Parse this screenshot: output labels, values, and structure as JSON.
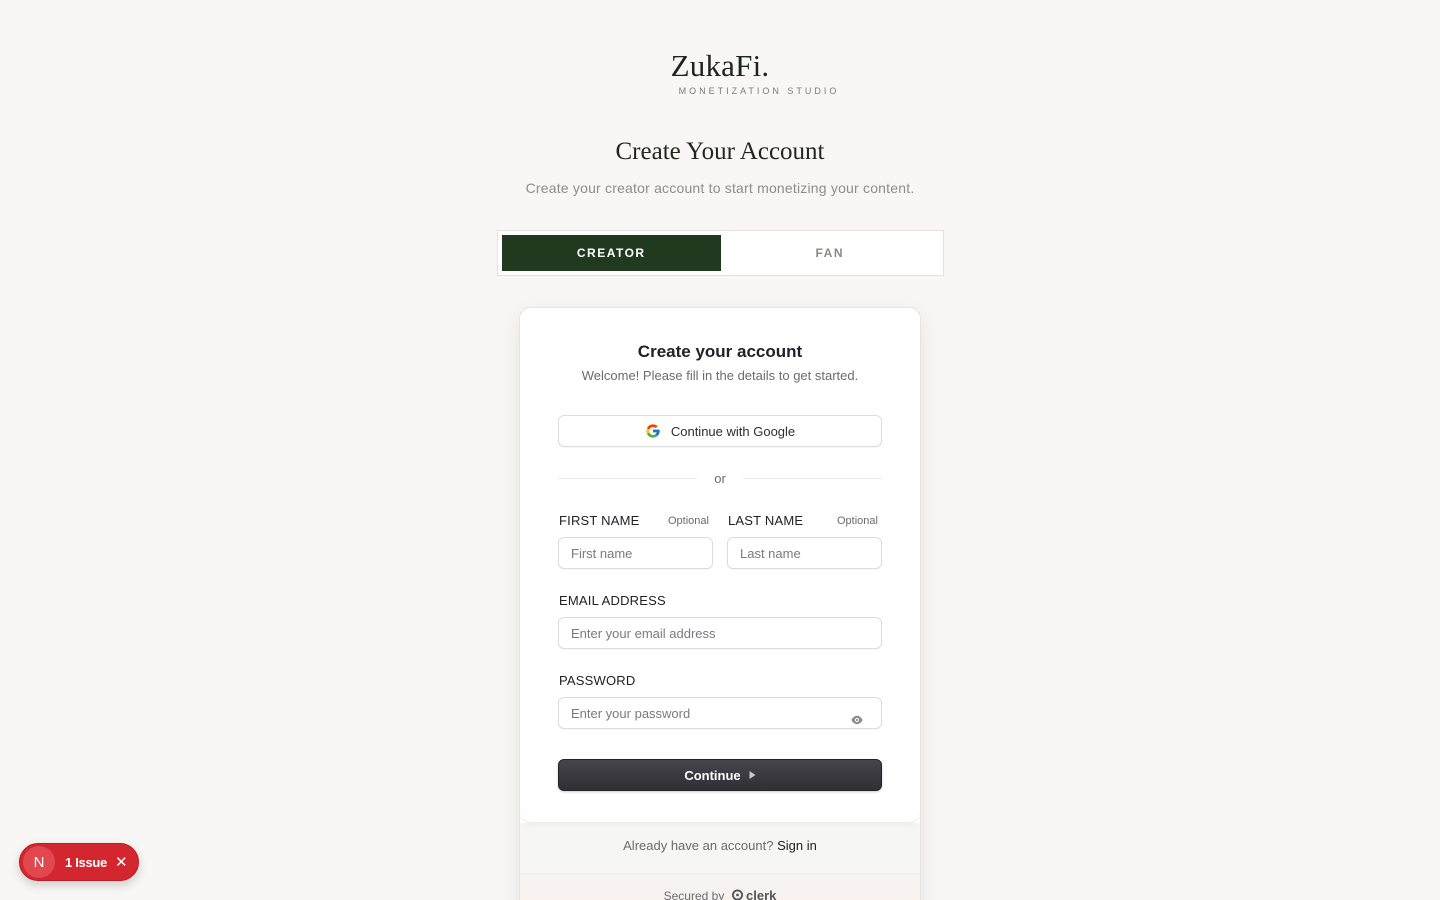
{
  "brand": {
    "name": "ZukaFi.",
    "tagline": "MONETIZATION STUDIO"
  },
  "page": {
    "heading": "Create Your Account",
    "subheading": "Create your creator account to start monetizing your content."
  },
  "role_toggle": {
    "creator": "CREATOR",
    "fan": "FAN",
    "selected": "CREATOR"
  },
  "card": {
    "title": "Create your account",
    "subtitle": "Welcome! Please fill in the details to get started.",
    "google_label": "Continue with Google",
    "divider": "or",
    "first_name": {
      "label": "FIRST NAME",
      "optional": "Optional",
      "placeholder": "First name"
    },
    "last_name": {
      "label": "LAST NAME",
      "optional": "Optional",
      "placeholder": "Last name"
    },
    "email": {
      "label": "EMAIL ADDRESS",
      "placeholder": "Enter your email address"
    },
    "password": {
      "label": "PASSWORD",
      "placeholder": "Enter your password"
    },
    "continue_label": "Continue",
    "signin_prompt": "Already have an account?",
    "signin_link": "Sign in",
    "secured_by": "Secured by",
    "secured_brand": "clerk"
  },
  "issue_badge": {
    "initial": "N",
    "text": "1 Issue"
  },
  "colors": {
    "accent": "#213a1f",
    "background": "#f8f7f5",
    "issue": "#d3262f"
  }
}
